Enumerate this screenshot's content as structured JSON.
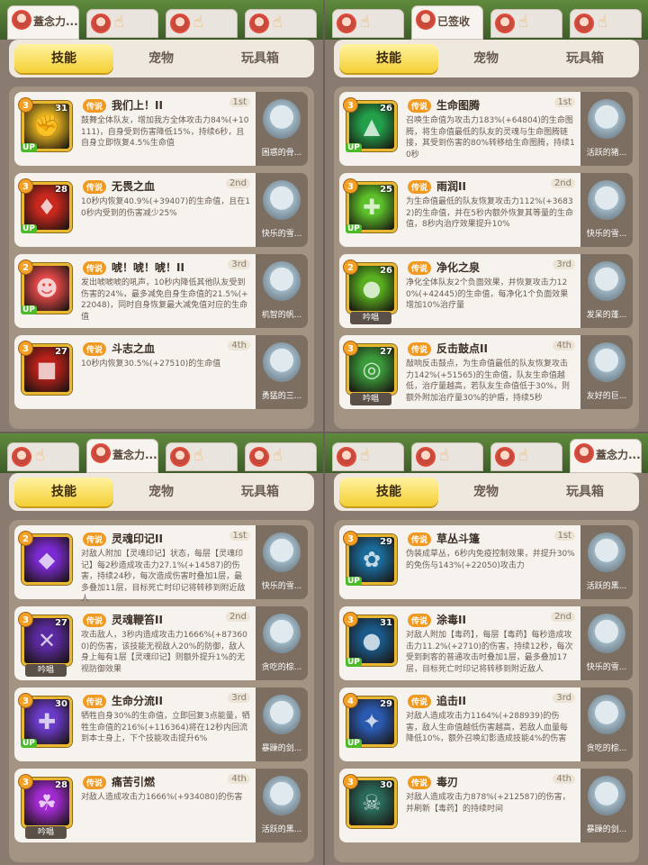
{
  "panels": [
    {
      "header_tab_text": "蓋念力...",
      "active_tab": 0,
      "tabs": [
        "技能",
        "宠物",
        "玩具箱"
      ],
      "cards": [
        {
          "badge": "3",
          "level": "31",
          "up": "UP",
          "chant": "",
          "legend": "传说",
          "name": "我们上！II",
          "rank": "1st",
          "desc": "鼓舞全体队友，增加我方全体攻击力84%(+10111)，自身受到伤害降低15%，持续6秒，且自身立即恢复4.5%生命值",
          "pet": "困惑的骨...",
          "icon_color": "#e0b020",
          "glyph": "✊"
        },
        {
          "badge": "3",
          "level": "28",
          "up": "UP",
          "chant": "",
          "legend": "传说",
          "name": "无畏之血",
          "rank": "2nd",
          "desc": "10秒内恢复40.9%(+39407)的生命值，且在10秒内受到的伤害减少25%",
          "pet": "快乐的雪...",
          "icon_color": "#c8281e",
          "glyph": "♦"
        },
        {
          "badge": "2",
          "level": "",
          "up": "UP",
          "chant": "",
          "legend": "传说",
          "name": "唬！唬！唬！II",
          "rank": "3rd",
          "desc": "发出唬唬唬的吼声，10秒内降低其他队友受到伤害的24%，最多减免自身生命值的21.5%(+22048)，同时自身恢复最大减免值对应的生命值",
          "pet": "机智的帆...",
          "icon_color": "#e04848",
          "glyph": "☻"
        },
        {
          "badge": "3",
          "level": "27",
          "up": "",
          "chant": "",
          "legend": "传说",
          "name": "斗志之血",
          "rank": "4th",
          "desc": "10秒内恢复30.5%(+27510)的生命值",
          "pet": "勇猛的三...",
          "icon_color": "#b8201a",
          "glyph": "■"
        }
      ]
    },
    {
      "header_tab_text": "已签收",
      "active_tab": 0,
      "tabs": [
        "技能",
        "宠物",
        "玩具箱"
      ],
      "cards": [
        {
          "badge": "3",
          "level": "26",
          "up": "UP",
          "chant": "",
          "legend": "传说",
          "name": "生命图腾",
          "rank": "1st",
          "desc": "召唤生命值为攻击力183%(+64804)的生命图腾，将生命值最低的队友的灵魂与生命图腾链接，其受到伤害的80%转移给生命图腾，持续10秒",
          "pet": "活跃的猪...",
          "icon_color": "#22a04a",
          "glyph": "▲"
        },
        {
          "badge": "3",
          "level": "25",
          "up": "UP",
          "chant": "",
          "legend": "传说",
          "name": "雨润II",
          "rank": "2nd",
          "desc": "为生命值最低的队友恢复攻击力112%(+36832)的生命值，并在5秒内额外恢复其等量的生命值，8秒内治疗效果提升10%",
          "pet": "快乐的雪...",
          "icon_color": "#5cc02a",
          "glyph": "✚"
        },
        {
          "badge": "2",
          "level": "26",
          "up": "",
          "chant": "吟唱",
          "legend": "传说",
          "name": "净化之泉",
          "rank": "3rd",
          "desc": "净化全体队友2个负面效果，并恢复攻击力120%(+42445)的生命值，每净化1个负面效果增加10%治疗量",
          "pet": "发呆的蓬...",
          "icon_color": "#58b020",
          "glyph": "●"
        },
        {
          "badge": "3",
          "level": "27",
          "up": "",
          "chant": "吟唱",
          "legend": "传说",
          "name": "反击鼓点II",
          "rank": "4th",
          "desc": "敲响反击鼓点，为生命值最低的队友恢复攻击力142%(+51565)的生命值，队友生命值越低，治疗量越高，若队友生命值低于30%，则额外附加治疗量30%的护盾，持续5秒",
          "pet": "友好的巨...",
          "icon_color": "#3a9a3a",
          "glyph": "◎"
        }
      ]
    },
    {
      "header_tab_text": "蓋念力...",
      "active_tab": 0,
      "tabs": [
        "技能",
        "宠物",
        "玩具箱"
      ],
      "cards": [
        {
          "badge": "2",
          "level": "",
          "up": "",
          "chant": "",
          "legend": "传说",
          "name": "灵魂印记II",
          "rank": "1st",
          "desc": "对敌人附加【灵魂印记】状态，每层【灵魂印记】每2秒造成攻击力27.1%(+14587)的伤害，持续24秒，每次造成伤害时叠加1层，最多叠加11层，目标死亡时印记将转移到附近敌人",
          "pet": "快乐的雪...",
          "icon_color": "#7a2ad0",
          "glyph": "◆"
        },
        {
          "badge": "3",
          "level": "27",
          "up": "",
          "chant": "吟唱",
          "legend": "传说",
          "name": "灵魂鞭笞II",
          "rank": "2nd",
          "desc": "攻击敌人，3秒内造成攻击力1666%(+873600)的伤害，该技能无视敌人20%的防御，敌人身上每有1层【灵魂印记】则额外提升1%的无视防御效果",
          "pet": "贪吃的棕...",
          "icon_color": "#5a2aa0",
          "glyph": "✕"
        },
        {
          "badge": "3",
          "level": "30",
          "up": "UP",
          "chant": "",
          "legend": "传说",
          "name": "生命分流II",
          "rank": "3rd",
          "desc": "牺牲自身30%的生命值，立即回复3点能量，牺牲生命值的216%(+116364)将在12秒内回流到本士身上，下个技能攻击提升6%",
          "pet": "暴躁的剑...",
          "icon_color": "#6a3ac8",
          "glyph": "✚"
        },
        {
          "badge": "3",
          "level": "28",
          "up": "",
          "chant": "吟唱",
          "legend": "传说",
          "name": "痛苦引燃",
          "rank": "4th",
          "desc": "对敌人造成攻击力1666%(+934080)的伤害",
          "pet": "活跃的黑...",
          "icon_color": "#a02ad0",
          "glyph": "☘"
        }
      ]
    },
    {
      "header_tab_text": "蓋念力...",
      "active_tab": 0,
      "tabs": [
        "技能",
        "宠物",
        "玩具箱"
      ],
      "cards": [
        {
          "badge": "3",
          "level": "29",
          "up": "UP",
          "chant": "",
          "legend": "传说",
          "name": "草丛斗篷",
          "rank": "1st",
          "desc": "伪装成草丛，6秒内免疫控制效果，并提升30%的免伤与143%(+22050)攻击力",
          "pet": "活跃的黑...",
          "icon_color": "#1a6a9a",
          "glyph": "✿"
        },
        {
          "badge": "3",
          "level": "31",
          "up": "UP",
          "chant": "",
          "legend": "传说",
          "name": "涂毒II",
          "rank": "2nd",
          "desc": "对敌人附加【毒药】，每层【毒药】每秒造成攻击力11.2%(+2710)的伤害，持续12秒，每次受到刺客的普通攻击时叠加1层，最多叠加17层，目标死亡时印记将转移到附近敌人",
          "pet": "快乐的雪...",
          "icon_color": "#1a5a8a",
          "glyph": "●"
        },
        {
          "badge": "4",
          "level": "29",
          "up": "UP",
          "chant": "",
          "legend": "传说",
          "name": "追击II",
          "rank": "3rd",
          "desc": "对敌人造成攻击力1164%(+288939)的伤害，敌人生命值越低伤害越高，若敌人血量每降低10%，额外召唤幻影造成技能4%的伤害",
          "pet": "贪吃的棕...",
          "icon_color": "#2a5ab0",
          "glyph": "✦"
        },
        {
          "badge": "3",
          "level": "30",
          "up": "",
          "chant": "",
          "legend": "传说",
          "name": "毒刃",
          "rank": "4th",
          "desc": "对敌人造成攻击力878%(+212587)的伤害，并刷新【毒药】的持续时间",
          "pet": "暴躁的剑...",
          "icon_color": "#2a6a5a",
          "glyph": "☠"
        }
      ]
    }
  ]
}
